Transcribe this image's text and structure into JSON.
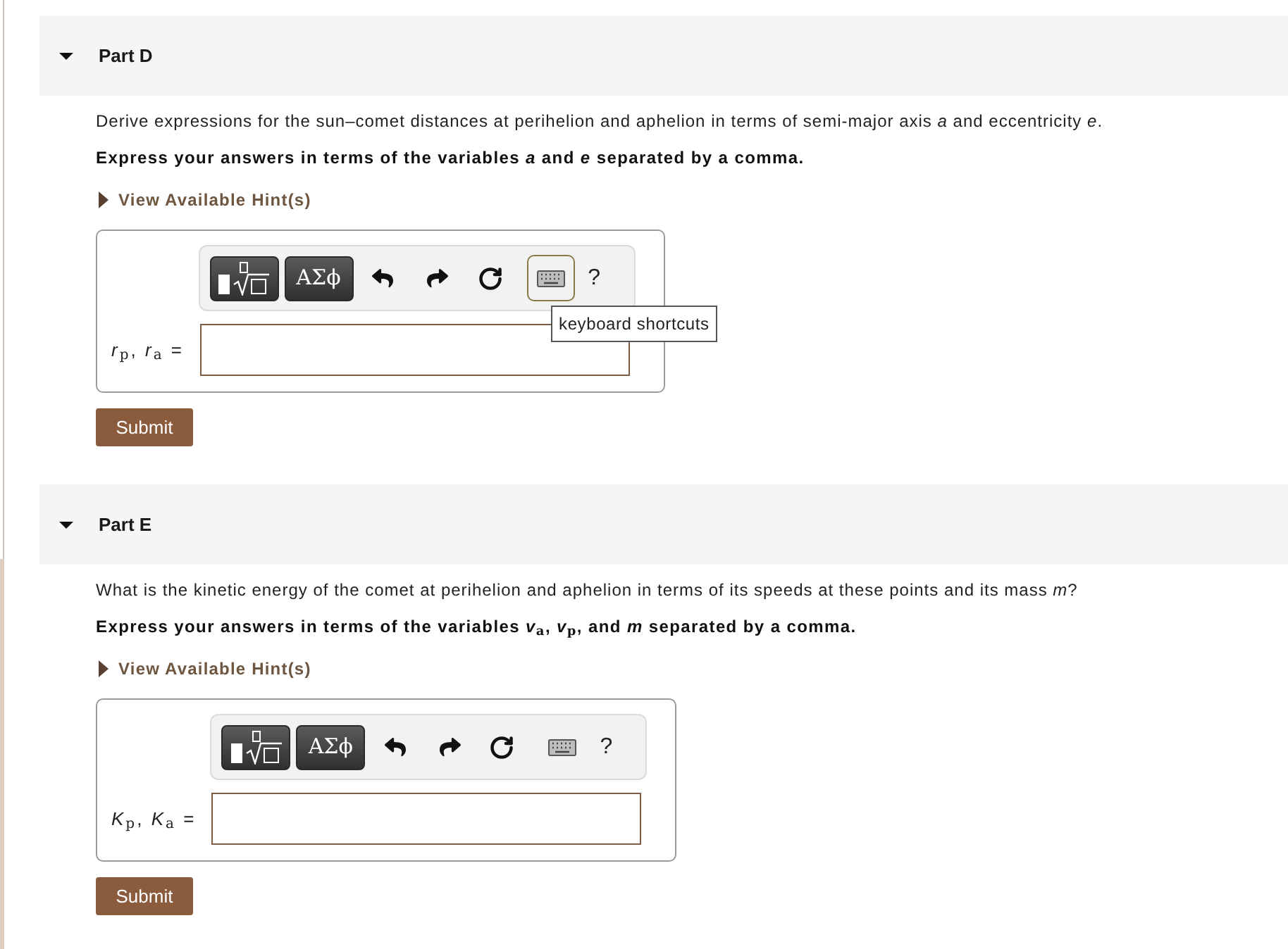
{
  "parts": [
    {
      "title": "Part D",
      "expanded": true,
      "prompt": "Derive expressions for the sun–comet distances at perihelion and aphelion in terms of semi-major axis *a* and eccentricity *e*.",
      "instruction": "Express your answers in terms of the variables *a* and *e* separated by a comma.",
      "hint": {
        "label": "View Available Hint(s)",
        "expanded": false
      },
      "toolbar": [
        {
          "kind": "templates",
          "hovered": false
        },
        {
          "kind": "symbols",
          "label": "ΑΣϕ",
          "hovered": false
        },
        {
          "kind": "undo",
          "hovered": false
        },
        {
          "kind": "redo",
          "hovered": false
        },
        {
          "kind": "reset",
          "hovered": false
        },
        {
          "kind": "keyboard",
          "hovered": true,
          "tooltip": "keyboard shortcuts"
        },
        {
          "kind": "help",
          "label": "?",
          "hovered": false
        }
      ],
      "answer_label": "*r*$_{p}$, *r*$_{a}$ =",
      "submit": "Submit"
    },
    {
      "title": "Part E",
      "expanded": true,
      "prompt": "What is the kinetic energy of the comet at perihelion and aphelion in terms of its speeds at these points and its mass *m*?",
      "instruction": "Express your answers in terms of the variables *v*$_{a}$, *v*$_{p}$, and *m* separated by a comma.",
      "hint": {
        "label": "View Available Hint(s)",
        "expanded": false
      },
      "toolbar": [
        {
          "kind": "templates",
          "hovered": false
        },
        {
          "kind": "symbols",
          "label": "ΑΣϕ",
          "hovered": false
        },
        {
          "kind": "undo",
          "hovered": false
        },
        {
          "kind": "redo",
          "hovered": false
        },
        {
          "kind": "reset",
          "hovered": false
        },
        {
          "kind": "keyboard",
          "hovered": false
        },
        {
          "kind": "help",
          "label": "?",
          "hovered": false
        }
      ],
      "answer_label": "*K*$_{p}$, *K*$_{a}$ =",
      "submit": "Submit"
    }
  ]
}
